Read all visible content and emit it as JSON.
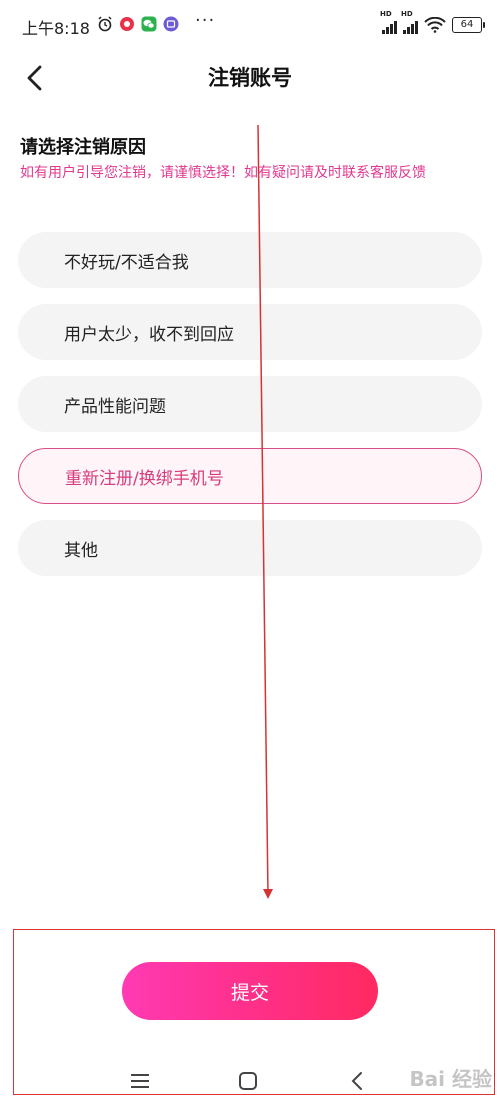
{
  "status_bar": {
    "time": "上午8:18",
    "more": "···",
    "signal_label": "HD",
    "battery": "64"
  },
  "header": {
    "title": "注销账号",
    "back_icon": "chevron-left-icon"
  },
  "section": {
    "title": "请选择注销原因",
    "warning": "如有用户引导您注销，请谨慎选择！如有疑问请及时联系客服反馈"
  },
  "options": [
    {
      "label": "不好玩/不适合我",
      "selected": false
    },
    {
      "label": "用户太少，收不到回应",
      "selected": false
    },
    {
      "label": "产品性能问题",
      "selected": false
    },
    {
      "label": "重新注册/换绑手机号",
      "selected": true
    },
    {
      "label": "其他",
      "selected": false
    }
  ],
  "submit": {
    "label": "提交"
  },
  "nav": {
    "menu_icon": "menu-icon",
    "home_icon": "home-square-icon",
    "back_icon": "back-chevron-icon"
  },
  "watermark": "Bai 经验",
  "colors": {
    "accent": "#e0398f",
    "selected_border": "#d64f86",
    "annotation_red": "#d33333",
    "button_gradient_start": "#ff3ab3",
    "button_gradient_end": "#ff2a60"
  }
}
